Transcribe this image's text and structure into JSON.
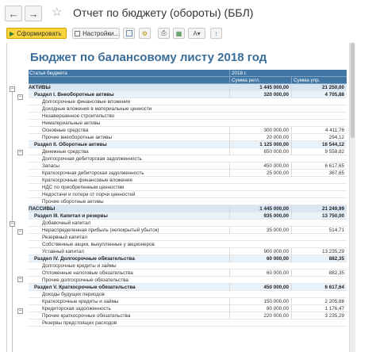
{
  "window": {
    "title": "Отчет по бюджету (обороты) (ББЛ)",
    "back_icon": "arrow-left-icon",
    "forward_icon": "arrow-right-icon",
    "favorite_icon": "star-icon"
  },
  "toolbar": {
    "generate_label": "Сформировать",
    "settings_label": "Настройки...",
    "colors": {
      "primary_bg": "#f9d43c"
    }
  },
  "report": {
    "title": "Бюджет по балансовому листу 2018 год",
    "header": {
      "col_article": "Статья бюджета",
      "period": "2018 г.",
      "col_sum_regl": "Сумма регл.",
      "col_sum_upr": "Сумма упр."
    },
    "rows": [
      {
        "kind": "group",
        "label": "АКТИВЫ",
        "regl": "1 445 000,00",
        "upr": "21 250,00"
      },
      {
        "kind": "section",
        "label": "Раздел I. Внеоборотные активы",
        "regl": "320 000,00",
        "upr": "4 705,88"
      },
      {
        "kind": "item",
        "label": "Долгосрочные финансовые вложения",
        "regl": "",
        "upr": ""
      },
      {
        "kind": "item",
        "label": "Доходные вложения в материальные ценности",
        "regl": "",
        "upr": ""
      },
      {
        "kind": "item",
        "label": "Незавершенное строительство",
        "regl": "",
        "upr": ""
      },
      {
        "kind": "item",
        "label": "Нематериальные активы",
        "regl": "",
        "upr": ""
      },
      {
        "kind": "item",
        "label": "Основные средства",
        "regl": "300 000,00",
        "upr": "4 411,76"
      },
      {
        "kind": "item",
        "label": "Прочие внеоборотные активы",
        "regl": "20 000,00",
        "upr": "294,12"
      },
      {
        "kind": "section",
        "label": "Раздел II. Оборотные активы",
        "regl": "1 125 000,00",
        "upr": "16 544,12"
      },
      {
        "kind": "item",
        "label": "Денежные средства",
        "regl": "650 000,00",
        "upr": "9 558,82"
      },
      {
        "kind": "item",
        "label": "Долгосрочная дебиторская задолженность",
        "regl": "",
        "upr": ""
      },
      {
        "kind": "item",
        "label": "Запасы",
        "regl": "450 000,00",
        "upr": "6 617,65"
      },
      {
        "kind": "item",
        "label": "Краткосрочная дебиторская задолженность",
        "regl": "25 000,00",
        "upr": "367,65"
      },
      {
        "kind": "item",
        "label": "Краткосрочные финансовые вложения",
        "regl": "",
        "upr": ""
      },
      {
        "kind": "item",
        "label": "НДС по приобретенным ценностям",
        "regl": "",
        "upr": ""
      },
      {
        "kind": "item",
        "label": "Недостачи и потери от порчи ценностей",
        "regl": "",
        "upr": ""
      },
      {
        "kind": "item",
        "label": "Прочие оборотные активы",
        "regl": "",
        "upr": ""
      },
      {
        "kind": "group",
        "label": "ПАССИВЫ",
        "regl": "1 445 000,00",
        "upr": "21 249,99"
      },
      {
        "kind": "section",
        "label": "Раздел III. Капитал и резервы",
        "regl": "935 000,00",
        "upr": "13 750,00"
      },
      {
        "kind": "item",
        "label": "Добавочный капитал",
        "regl": "",
        "upr": ""
      },
      {
        "kind": "item",
        "label": "Нераспределенная прибыль (непокрытый убыток)",
        "regl": "35 000,00",
        "upr": "514,71"
      },
      {
        "kind": "item",
        "label": "Резервный капитал",
        "regl": "",
        "upr": ""
      },
      {
        "kind": "item",
        "label": "Собственные акции, выкупленные у акционеров",
        "regl": "",
        "upr": ""
      },
      {
        "kind": "item",
        "label": "Уставный капитал",
        "regl": "900 000,00",
        "upr": "13 235,29"
      },
      {
        "kind": "section",
        "label": "Раздел IV. Долгосрочные обязательства",
        "regl": "60 000,00",
        "upr": "882,35"
      },
      {
        "kind": "item",
        "label": "Долгосрочные кредиты и займы",
        "regl": "",
        "upr": ""
      },
      {
        "kind": "item",
        "label": "Отложенные налоговые обязательства",
        "regl": "60 000,00",
        "upr": "882,35"
      },
      {
        "kind": "item",
        "label": "Прочие долгосрочные обязательства",
        "regl": "",
        "upr": ""
      },
      {
        "kind": "section",
        "label": "Раздел V. Краткосрочные обязательства",
        "regl": "450 000,00",
        "upr": "6 617,64"
      },
      {
        "kind": "item",
        "label": "Доходы будущих периодов",
        "regl": "",
        "upr": ""
      },
      {
        "kind": "item",
        "label": "Краткосрочные кредиты и займы",
        "regl": "150 000,00",
        "upr": "2 205,88"
      },
      {
        "kind": "item",
        "label": "Кредиторская задолженность",
        "regl": "80 000,00",
        "upr": "1 176,47"
      },
      {
        "kind": "item",
        "label": "Прочие краткосрочные обязательства",
        "regl": "220 000,00",
        "upr": "3 235,29"
      },
      {
        "kind": "item",
        "label": "Резервы предстоящих расходов",
        "regl": "",
        "upr": ""
      }
    ]
  }
}
